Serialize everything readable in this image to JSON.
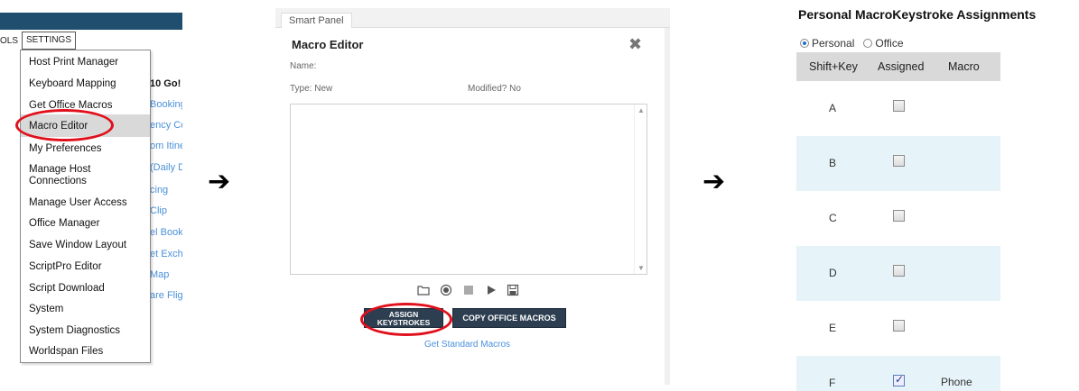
{
  "panel1": {
    "tools_tab_fragment": "OLS",
    "settings_tab": "SETTINGS",
    "menu_items": [
      "Host Print Manager",
      "Keyboard Mapping",
      "Get Office Macros",
      "Macro Editor",
      "My Preferences",
      "Manage Host Connections",
      "Manage User Access",
      "Office Manager",
      "Save Window Layout",
      "ScriptPro Editor",
      "Script Download",
      "System",
      "System Diagnostics",
      "Worldspan Files"
    ],
    "highlighted_item": "Macro Editor",
    "behind_fragments": [
      "10 Go!",
      "Booking",
      "ency Co",
      "om Itine",
      "(Daily D",
      "cing",
      "Clip",
      "el Bookin",
      "et Excha",
      "Map",
      "are Fligh"
    ]
  },
  "arrows": [
    "➔",
    "➔"
  ],
  "panel2": {
    "tab_label": "Smart Panel",
    "title": "Macro Editor",
    "close_icon": "✖",
    "name_label": "Name:",
    "type_label": "Type: New",
    "modified_label": "Modified? No",
    "toolbar_icons": [
      "folder-icon",
      "record-icon",
      "stop-icon",
      "play-icon",
      "save-icon"
    ],
    "assign_button_line1": "ASSIGN",
    "assign_button_line2": "KEYSTROKES",
    "copy_button": "COPY OFFICE MACROS",
    "link": "Get Standard Macros"
  },
  "panel3": {
    "title": "Personal MacroKeystroke Assignments",
    "radio_personal": "Personal",
    "radio_office": "Office",
    "selected_radio": "Personal",
    "columns": [
      "Shift+Key",
      "Assigned",
      "Macro"
    ],
    "rows": [
      {
        "key": "A",
        "assigned": false,
        "macro": ""
      },
      {
        "key": "B",
        "assigned": false,
        "macro": ""
      },
      {
        "key": "C",
        "assigned": false,
        "macro": ""
      },
      {
        "key": "D",
        "assigned": false,
        "macro": ""
      },
      {
        "key": "E",
        "assigned": false,
        "macro": ""
      },
      {
        "key": "F",
        "assigned": true,
        "macro": "Phone"
      }
    ]
  },
  "colors": {
    "topbar": "#1f4e6e",
    "highlight_ellipse": "#e0101c",
    "dark_button": "#2c3e50",
    "link": "#4a90d9",
    "alt_row": "#e6f3f8"
  }
}
